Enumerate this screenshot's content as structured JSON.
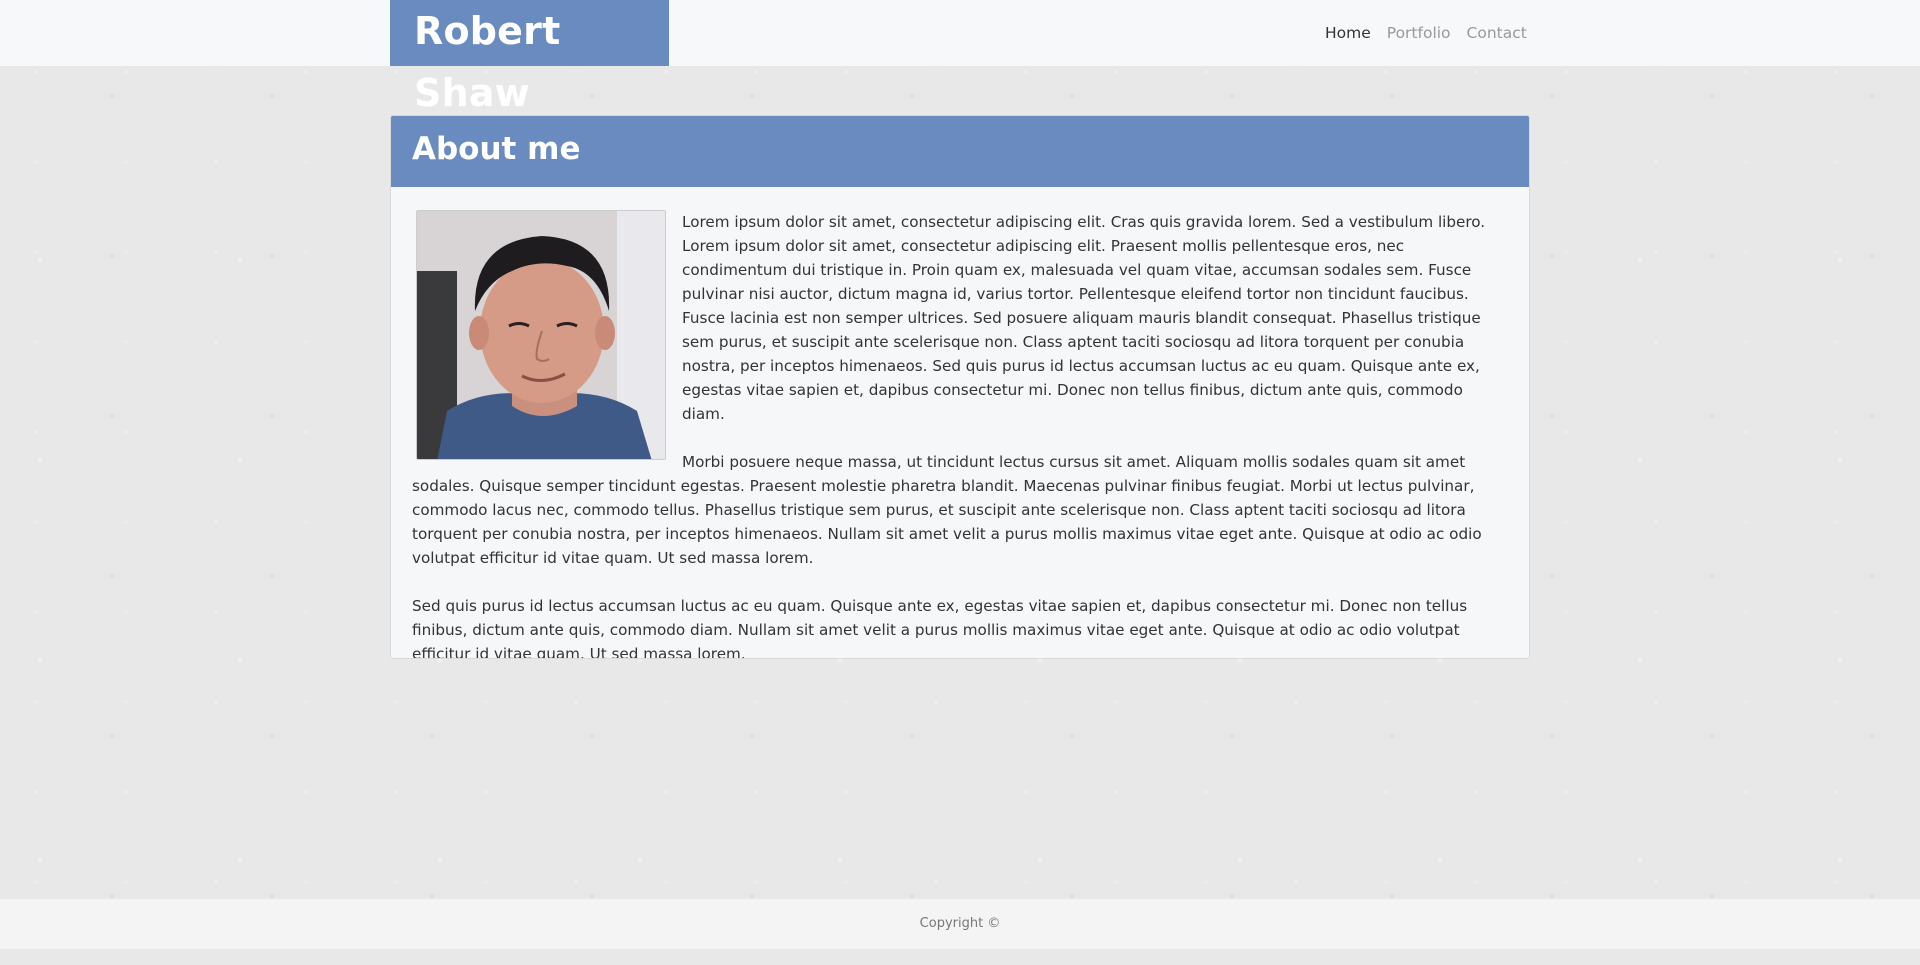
{
  "navbar": {
    "brand": "Robert Shaw",
    "links": [
      "Home",
      "Portfolio",
      "Contact"
    ],
    "active_link": "Home"
  },
  "about": {
    "title": "About me",
    "photo_alt": "portrait-photo",
    "paragraphs": [
      "Lorem ipsum dolor sit amet, consectetur adipiscing elit. Cras quis gravida lorem. Sed a vestibulum libero. Lorem ipsum dolor sit amet, consectetur adipiscing elit. Praesent mollis pellentesque eros, nec condimentum dui tristique in. Proin quam ex, malesuada vel quam vitae, accumsan sodales sem. Fusce pulvinar nisi auctor, dictum magna id, varius tortor. Pellentesque eleifend tortor non tincidunt faucibus. Fusce lacinia est non semper ultrices. Sed posuere aliquam mauris blandit consequat. Phasellus tristique sem purus, et suscipit ante scelerisque non. Class aptent taciti sociosqu ad litora torquent per conubia nostra, per inceptos himenaeos. Sed quis purus id lectus accumsan luctus ac eu quam. Quisque ante ex, egestas vitae sapien et, dapibus consectetur mi. Donec non tellus finibus, dictum ante quis, commodo diam.",
      "Morbi posuere neque massa, ut tincidunt lectus cursus sit amet. Aliquam mollis sodales quam sit amet sodales. Quisque semper tincidunt egestas. Praesent molestie pharetra blandit. Maecenas pulvinar finibus feugiat. Morbi ut lectus pulvinar, commodo lacus nec, commodo tellus. Phasellus tristique sem purus, et suscipit ante scelerisque non. Class aptent taciti sociosqu ad litora torquent per conubia nostra, per inceptos himenaeos. Nullam sit amet velit a purus mollis maximus vitae eget ante. Quisque at odio ac odio volutpat efficitur id vitae quam. Ut sed massa lorem.",
      "Sed quis purus id lectus accumsan luctus ac eu quam. Quisque ante ex, egestas vitae sapien et, dapibus consectetur mi. Donec non tellus finibus, dictum ante quis, commodo diam. Nullam sit amet velit a purus mollis maximus vitae eget ante. Quisque at odio ac odio volutpat efficitur id vitae quam. Ut sed massa lorem."
    ]
  },
  "footer": {
    "text": "Copyright ©"
  },
  "colors": {
    "accent": "#6a8bbf",
    "panel_bg": "#f6f7f9",
    "navbar_bg": "#f7f8fa"
  }
}
